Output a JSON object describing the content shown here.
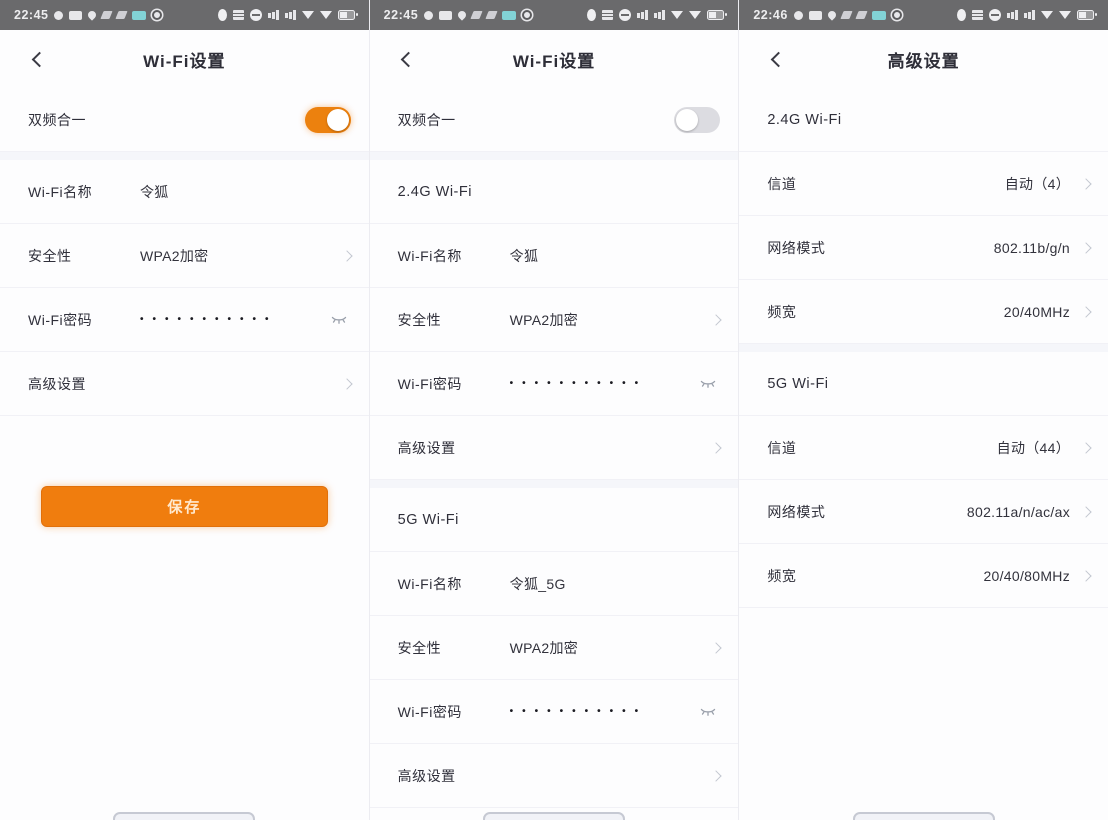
{
  "colors": {
    "accent_orange": "#EE7D10",
    "statusbar_bg": "#6A6A6C",
    "page_bg": "#FDFDFE",
    "toggle_off_track": "#DCDCE1",
    "divider": "#F1F1F6"
  },
  "icons": {
    "back": "chevron-left",
    "row_disclosure": "chevron-right",
    "password_visibility": "eye-off",
    "statusbar_left": [
      "record-icon",
      "sim-card-icon",
      "location-icon",
      "app-icon-1",
      "app-icon-2",
      "messages-app-icon",
      "camera-icon"
    ],
    "statusbar_right": [
      "dnd-oval-icon",
      "grid-icon",
      "minus-circle-icon",
      "cellular-signal-icon",
      "cellular-signal-icon-2",
      "wifi-triangle-icon",
      "wifi-triangle-icon-2",
      "battery-icon"
    ]
  },
  "panels": [
    {
      "time": "22:45",
      "title": "Wi-Fi设置",
      "toggle": {
        "label": "双频合一",
        "state": "on"
      },
      "rows": [
        {
          "label": "Wi-Fi名称",
          "value": "令狐"
        },
        {
          "label": "安全性",
          "value": "WPA2加密"
        },
        {
          "label": "Wi-Fi密码",
          "value": "•••••••••••"
        },
        {
          "label": "高级设置",
          "value": ""
        }
      ],
      "save_label": "保存"
    },
    {
      "time": "22:45",
      "title": "Wi-Fi设置",
      "toggle": {
        "label": "双频合一",
        "state": "off"
      },
      "sections": [
        {
          "header": "2.4G Wi-Fi",
          "rows": [
            {
              "label": "Wi-Fi名称",
              "value": "令狐"
            },
            {
              "label": "安全性",
              "value": "WPA2加密"
            },
            {
              "label": "Wi-Fi密码",
              "value": "•••••••••••"
            },
            {
              "label": "高级设置",
              "value": ""
            }
          ]
        },
        {
          "header": "5G Wi-Fi",
          "rows": [
            {
              "label": "Wi-Fi名称",
              "value": "令狐_5G"
            },
            {
              "label": "安全性",
              "value": "WPA2加密"
            },
            {
              "label": "Wi-Fi密码",
              "value": "•••••••••••"
            },
            {
              "label": "高级设置",
              "value": ""
            }
          ]
        }
      ]
    },
    {
      "time": "22:46",
      "title": "高级设置",
      "sections": [
        {
          "header": "2.4G Wi-Fi",
          "rows": [
            {
              "label": "信道",
              "value": "自动（4）"
            },
            {
              "label": "网络模式",
              "value": "802.11b/g/n"
            },
            {
              "label": "频宽",
              "value": "20/40MHz"
            }
          ]
        },
        {
          "header": "5G Wi-Fi",
          "rows": [
            {
              "label": "信道",
              "value": "自动（44）"
            },
            {
              "label": "网络模式",
              "value": "802.11a/n/ac/ax"
            },
            {
              "label": "频宽",
              "value": "20/40/80MHz"
            }
          ]
        }
      ]
    }
  ]
}
